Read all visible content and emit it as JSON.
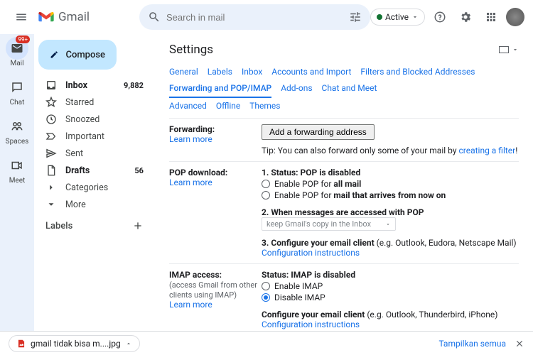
{
  "header": {
    "product_name": "Gmail",
    "search_placeholder": "Search in mail",
    "status_label": "Active"
  },
  "rail": {
    "mail": "Mail",
    "mail_badge": "99+",
    "chat": "Chat",
    "spaces": "Spaces",
    "meet": "Meet"
  },
  "sidebar": {
    "compose": "Compose",
    "items": [
      {
        "label": "Inbox",
        "count": "9,882",
        "bold": true
      },
      {
        "label": "Starred"
      },
      {
        "label": "Snoozed"
      },
      {
        "label": "Important"
      },
      {
        "label": "Sent"
      },
      {
        "label": "Drafts",
        "count": "56",
        "bold": true
      },
      {
        "label": "Categories"
      },
      {
        "label": "More"
      }
    ],
    "labels_heading": "Labels"
  },
  "settings": {
    "title": "Settings",
    "tabs": [
      "General",
      "Labels",
      "Inbox",
      "Accounts and Import",
      "Filters and Blocked Addresses",
      "Forwarding and POP/IMAP",
      "Add-ons",
      "Chat and Meet",
      "Advanced",
      "Offline",
      "Themes"
    ],
    "active_tab": "Forwarding and POP/IMAP",
    "forwarding": {
      "label": "Forwarding:",
      "learn": "Learn more",
      "button": "Add a forwarding address",
      "tip_prefix": "Tip: You can also forward only some of your mail by ",
      "tip_link": "creating a filter",
      "tip_suffix": "!"
    },
    "pop": {
      "label": "POP download:",
      "learn": "Learn more",
      "status_prefix": "1. Status: ",
      "status_value": "POP is disabled",
      "opt1_prefix": "Enable POP for ",
      "opt1_bold": "all mail",
      "opt2_prefix": "Enable POP for ",
      "opt2_bold": "mail that arrives from now on",
      "line2_prefix": "2. When messages are accessed with POP",
      "select_value": "keep Gmail's copy in the Inbox",
      "line3_prefix": "3. Configure your email client ",
      "line3_suffix": "(e.g. Outlook, Eudora, Netscape Mail)",
      "config_link": "Configuration instructions"
    },
    "imap": {
      "label": "IMAP access:",
      "sub": "(access Gmail from other clients using IMAP)",
      "learn": "Learn more",
      "status_prefix": "Status: ",
      "status_value": "IMAP is disabled",
      "opt1": "Enable IMAP",
      "opt2": "Disable IMAP",
      "config_prefix": "Configure your email client ",
      "config_suffix": "(e.g. Outlook, Thunderbird, iPhone)",
      "config_link": "Configuration instructions"
    }
  },
  "downloads": {
    "file": "gmail tidak bisa m....jpg",
    "show_all": "Tampilkan semua"
  }
}
